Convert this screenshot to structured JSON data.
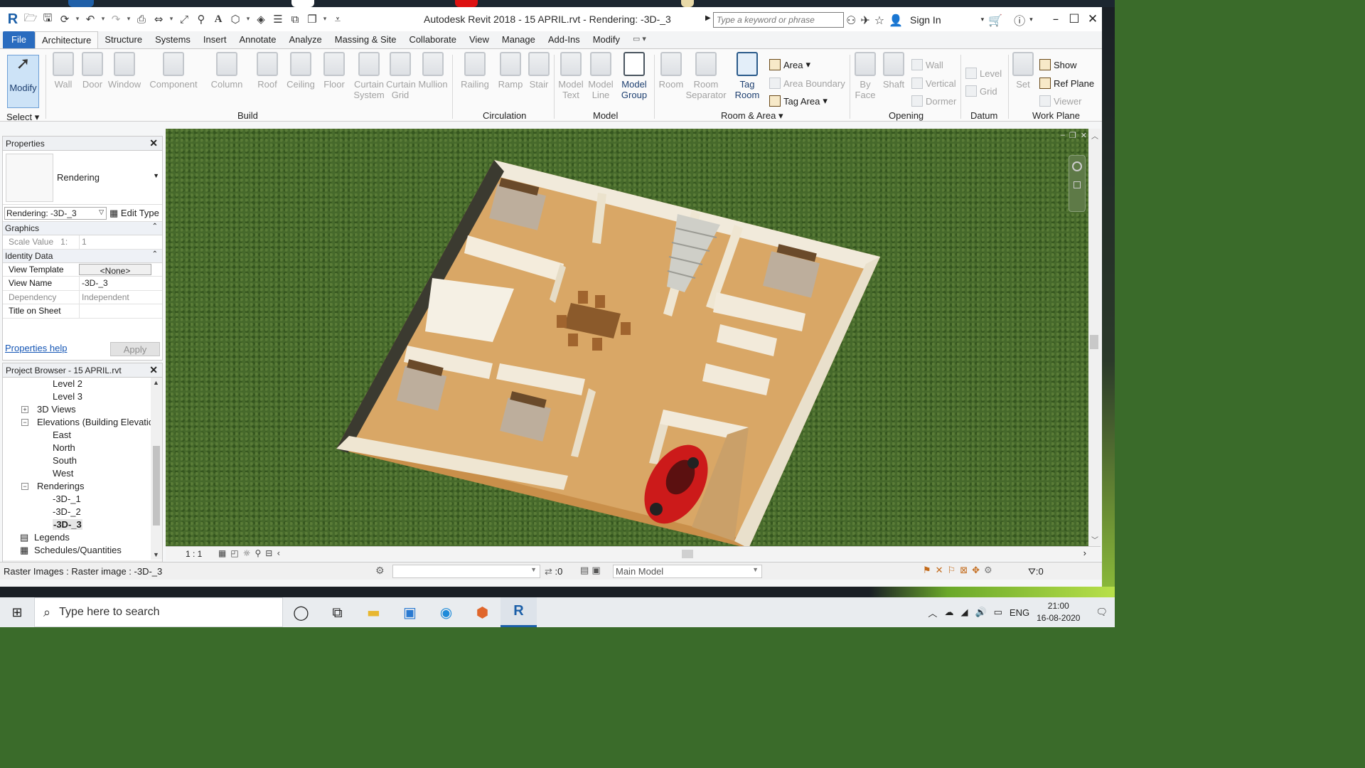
{
  "window": {
    "title": "Autodesk Revit 2018 -    15 APRIL.rvt - Rendering: -3D-_3",
    "search_placeholder": "Type a keyword or phrase",
    "sign_in": "Sign In"
  },
  "tabs": [
    {
      "label": "File"
    },
    {
      "label": "Architecture"
    },
    {
      "label": "Structure"
    },
    {
      "label": "Systems"
    },
    {
      "label": "Insert"
    },
    {
      "label": "Annotate"
    },
    {
      "label": "Analyze"
    },
    {
      "label": "Massing & Site"
    },
    {
      "label": "Collaborate"
    },
    {
      "label": "View"
    },
    {
      "label": "Manage"
    },
    {
      "label": "Add-Ins"
    },
    {
      "label": "Modify"
    }
  ],
  "ribbon": {
    "modify": "Modify",
    "select": "Select",
    "build": [
      "Wall",
      "Door",
      "Window",
      "Component",
      "Column",
      "Roof",
      "Ceiling",
      "Floor"
    ],
    "curtain_system": [
      "Curtain",
      "System"
    ],
    "curtain_grid": [
      "Curtain",
      "Grid"
    ],
    "mullion": "Mullion",
    "circulation": [
      "Railing",
      "Ramp",
      "Stair"
    ],
    "model_text": [
      "Model",
      "Text"
    ],
    "model_line": [
      "Model",
      "Line"
    ],
    "model_group": [
      "Model",
      "Group"
    ],
    "room": "Room",
    "room_separator": [
      "Room",
      "Separator"
    ],
    "tag_room": [
      "Tag",
      "Room"
    ],
    "area": "Area",
    "area_boundary": "Area  Boundary",
    "tag_area": "Tag  Area",
    "by_face": [
      "By",
      "Face"
    ],
    "shaft": "Shaft",
    "wall_open": "Wall",
    "vertical": "Vertical",
    "dormer": "Dormer",
    "level": "Level",
    "grid": "Grid",
    "set": "Set",
    "show": "Show",
    "ref_plane": "Ref  Plane",
    "viewer": "Viewer",
    "groups": {
      "build": "Build",
      "circulation": "Circulation",
      "model": "Model",
      "room_area": "Room & Area",
      "opening": "Opening",
      "datum": "Datum",
      "work_plane": "Work Plane"
    }
  },
  "properties": {
    "header": "Properties",
    "type_name": "Rendering",
    "instance": "Rendering: -3D-_3",
    "edit_type": "Edit Type",
    "sections": {
      "graphics": "Graphics",
      "identity": "Identity Data"
    },
    "scale_label": "Scale Value",
    "scale_prefix": "1:",
    "scale_value": "1",
    "rows": [
      {
        "key": "View Template",
        "value": "<None>"
      },
      {
        "key": "View Name",
        "value": "-3D-_3"
      },
      {
        "key": "Dependency",
        "value": "Independent"
      },
      {
        "key": "Title on Sheet",
        "value": ""
      }
    ],
    "help": "Properties help",
    "apply": "Apply"
  },
  "browser": {
    "header": "Project Browser - 15 APRIL.rvt",
    "items": [
      {
        "label": "Level 2"
      },
      {
        "label": "Level 3"
      },
      {
        "label": "3D Views"
      },
      {
        "label": "Elevations (Building Elevation"
      },
      {
        "label": "East"
      },
      {
        "label": "North"
      },
      {
        "label": "South"
      },
      {
        "label": "West"
      },
      {
        "label": "Renderings"
      },
      {
        "label": "-3D-_1"
      },
      {
        "label": "-3D-_2"
      },
      {
        "label": "-3D-_3"
      },
      {
        "label": "Legends"
      },
      {
        "label": "Schedules/Quantities"
      }
    ]
  },
  "viewbar": {
    "scale": "1 : 1"
  },
  "status": {
    "text": "Raster Images : Raster image : -3D-_3",
    "zero": ":0",
    "model": "Main Model",
    "filter": ":0"
  },
  "taskbar": {
    "search": "Type here to search",
    "lang": "ENG",
    "time": "21:00",
    "date": "16-08-2020"
  },
  "colors": {
    "file_tab": "#2a6cbf",
    "floor": "#d9a766",
    "grass": "#46692b",
    "car": "#d11c1c"
  }
}
